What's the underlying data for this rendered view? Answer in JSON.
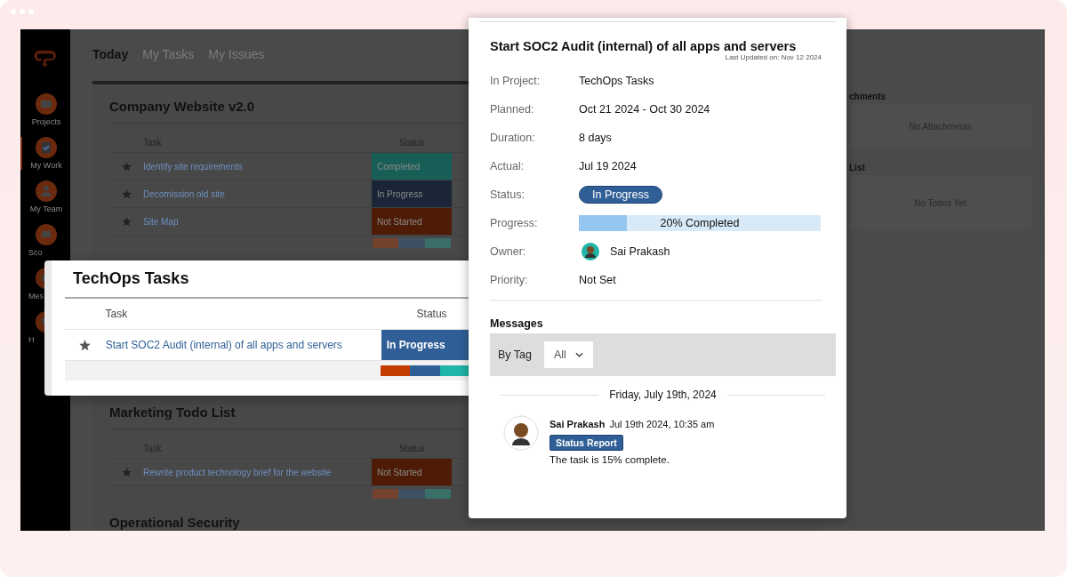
{
  "sidebar": {
    "items": [
      {
        "label": "Projects",
        "selected": false
      },
      {
        "label": "My Work",
        "selected": true
      },
      {
        "label": "My Team",
        "selected": false
      },
      {
        "label": "Sco",
        "selected": false
      },
      {
        "label": "Mes",
        "selected": false
      },
      {
        "label": "H",
        "selected": false
      }
    ]
  },
  "tabs": [
    {
      "label": "Today",
      "selected": true
    },
    {
      "label": "My Tasks",
      "selected": false
    },
    {
      "label": "My Issues",
      "selected": false
    }
  ],
  "projects": [
    {
      "title": "Company Website v2.0",
      "columns": [
        "Task",
        "Status"
      ],
      "rows": [
        {
          "task": "Identify site requirements",
          "status": "Completed",
          "kind": "completed"
        },
        {
          "task": "Decomission old site",
          "status": "In Progress",
          "kind": "in_progress"
        },
        {
          "task": "Site Map",
          "status": "Not Started",
          "kind": "not_started"
        }
      ]
    },
    {
      "kind": "hidden"
    },
    {
      "title": "Marketing Todo List",
      "columns": [
        "Task",
        "Status"
      ],
      "rows": [
        {
          "task": "Rewrite product technology brief for the website",
          "status": "Not Started",
          "kind": "not_started"
        }
      ]
    },
    {
      "title": "Operational Security"
    }
  ],
  "side_panels": [
    {
      "heading": "chments",
      "empty_text": "No Attachments"
    },
    {
      "heading": "List",
      "empty_text": "No Todos Yet"
    }
  ],
  "highlighted_project": {
    "title": "TechOps Tasks",
    "columns": [
      "Task",
      "Status"
    ],
    "rows": [
      {
        "task": "Start SOC2 Audit (internal) of all apps and servers",
        "status": "In Progress",
        "kind": "in_progress"
      }
    ]
  },
  "task_detail": {
    "title": "Start SOC2 Audit (internal) of all apps and servers",
    "last_updated": "Last Updated on: Nov 12 2024",
    "fields": [
      {
        "kind": "text",
        "label": "In Project:",
        "value": "TechOps Tasks"
      },
      {
        "kind": "text",
        "label": "Planned:",
        "value": "Oct 21 2024 - Oct 30 2024"
      },
      {
        "kind": "text",
        "label": "Duration:",
        "value": "8 days"
      },
      {
        "kind": "text",
        "label": "Actual:",
        "value": "Jul 19 2024"
      },
      {
        "kind": "status",
        "label": "Status:",
        "value": "In Progress"
      },
      {
        "kind": "progress",
        "label": "Progress:",
        "value": "20% Completed",
        "level": 0.2
      },
      {
        "kind": "owner",
        "label": "Owner:",
        "value": "Sai Prakash"
      },
      {
        "kind": "text",
        "label": "Priority:",
        "value": "Not Set"
      }
    ],
    "messages": {
      "heading": "Messages",
      "filter_label": "By Tag",
      "filter_value": "All",
      "date": "Friday, July 19th, 2024",
      "items": [
        {
          "author": "Sai Prakash",
          "time": "Jul 19th 2024, 10:35 am",
          "tag": "Status Report",
          "text": "The task is 15% complete."
        }
      ]
    }
  }
}
